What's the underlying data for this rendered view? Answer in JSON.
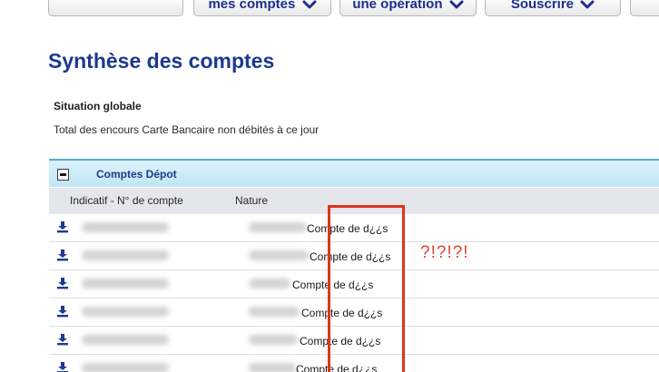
{
  "nav": {
    "items": [
      {
        "label": "mes comptes"
      },
      {
        "label": "une opération"
      },
      {
        "label": "Souscrire"
      }
    ]
  },
  "page": {
    "title": "Synthèse des comptes",
    "subhead": "Situation globale",
    "total_line": "Total des encours Carte Bancaire non débités à ce jour"
  },
  "section": {
    "title": "Comptes Dépot",
    "columns": {
      "account": "Indicatif - N° de compte",
      "nature": "Nature"
    },
    "rows": [
      {
        "nature": "Compte de d¿¿s"
      },
      {
        "nature": "Compte de d¿¿s"
      },
      {
        "nature": "Compte de d¿¿s"
      },
      {
        "nature": "Compte de d¿¿s"
      },
      {
        "nature": "Compte de d¿¿s"
      },
      {
        "nature": "Compte de d¿¿s"
      }
    ]
  },
  "annotation": {
    "text": "?!?!?!",
    "color": "#d9371e"
  },
  "colors": {
    "title_blue": "#1c3a8e",
    "section_bg": "#c9ebf7",
    "header_bg": "#e5e5ec"
  }
}
